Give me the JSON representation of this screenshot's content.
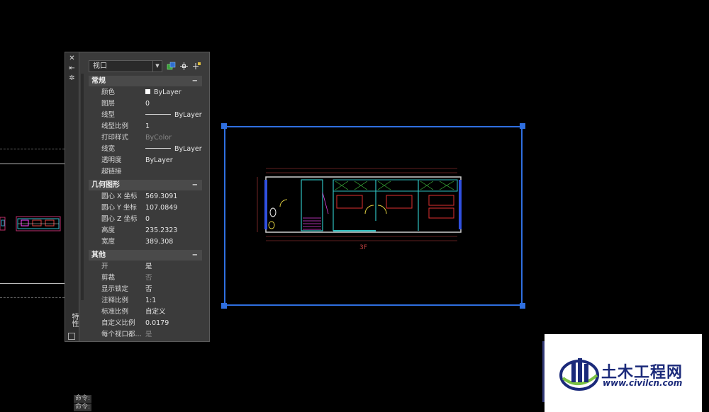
{
  "palette": {
    "strip_title": "特性",
    "viewport_type": "视口",
    "sections": [
      {
        "title": "常规",
        "collapse": "−",
        "rows": [
          {
            "name": "颜色",
            "value": "ByLayer"
          },
          {
            "name": "图层",
            "value": "0"
          },
          {
            "name": "线型",
            "value": "ByLayer"
          },
          {
            "name": "线型比例",
            "value": "1"
          },
          {
            "name": "打印样式",
            "value": "ByColor"
          },
          {
            "name": "线宽",
            "value": "ByLayer"
          },
          {
            "name": "透明度",
            "value": "ByLayer"
          },
          {
            "name": "超链接",
            "value": ""
          }
        ]
      },
      {
        "title": "几何图形",
        "collapse": "−",
        "rows": [
          {
            "name": "圆心 X 坐标",
            "value": "569.3091"
          },
          {
            "name": "圆心 Y 坐标",
            "value": "107.0849"
          },
          {
            "name": "圆心 Z 坐标",
            "value": "0"
          },
          {
            "name": "高度",
            "value": "235.2323"
          },
          {
            "name": "宽度",
            "value": "389.308"
          }
        ]
      },
      {
        "title": "其他",
        "collapse": "−",
        "rows": [
          {
            "name": "开",
            "value": "是"
          },
          {
            "name": "剪裁",
            "value": "否"
          },
          {
            "name": "显示锁定",
            "value": "否"
          },
          {
            "name": "注释比例",
            "value": "1:1"
          },
          {
            "name": "标准比例",
            "value": "自定义"
          },
          {
            "name": "自定义比例",
            "value": "0.0179"
          },
          {
            "name": "每个视口都...",
            "value": "是"
          }
        ]
      }
    ]
  },
  "command_line": [
    "命令:",
    "命令:"
  ],
  "drawing": {
    "floor_label": "3F"
  },
  "logo": {
    "title": "土木工程网",
    "url": "www.civilcn.com"
  },
  "colors": {
    "viewport_frame": "#2f6fe0",
    "palette_bg": "#3b3b3b",
    "logo_text": "#1b2a7a"
  }
}
